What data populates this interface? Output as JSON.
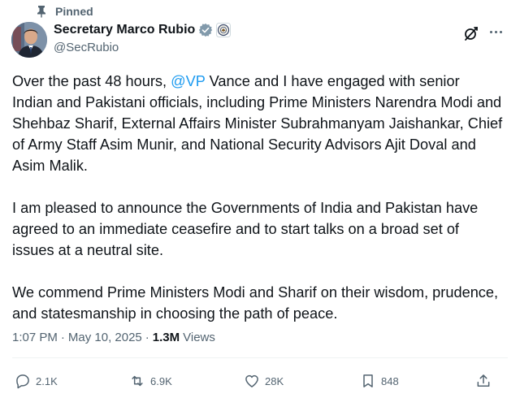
{
  "pinned_label": "Pinned",
  "author": {
    "display_name": "Secretary Marco Rubio",
    "handle": "@SecRubio"
  },
  "tweet": {
    "paragraphs": [
      {
        "before": "Over the past 48 hours, ",
        "mention": "@VP",
        "after": " Vance and I have engaged with senior Indian and Pakistani officials, including Prime Ministers Narendra Modi and Shehbaz Sharif, External Affairs Minister Subrahmanyam Jaishankar, Chief of Army Staff Asim Munir, and National Security Advisors Ajit Doval and Asim Malik."
      },
      {
        "text": "I am pleased to announce the Governments of India and Pakistan have agreed to an immediate ceasefire and to start talks on a broad set of issues at a neutral site."
      },
      {
        "text": "We commend Prime Ministers Modi and Sharif on their wisdom, prudence, and statesmanship in choosing the path of peace."
      }
    ],
    "time": "1:07 PM",
    "date": "May 10, 2025",
    "views_count": "1.3M",
    "views_label": "Views"
  },
  "actions": {
    "replies": "2.1K",
    "reposts": "6.9K",
    "likes": "28K",
    "bookmarks": "848"
  },
  "icons": {
    "pin": "pin-icon",
    "verified": "verified-badge-icon",
    "affiliation": "state-department-seal-icon",
    "grok": "grok-icon",
    "more": "more-icon",
    "reply": "reply-icon",
    "repost": "repost-icon",
    "like": "heart-icon",
    "bookmark": "bookmark-icon",
    "share": "share-icon"
  },
  "colors": {
    "link": "#1d9bf0",
    "secondary_text": "#536471",
    "primary_text": "#0f1419",
    "verified_badge": "#829aab"
  }
}
